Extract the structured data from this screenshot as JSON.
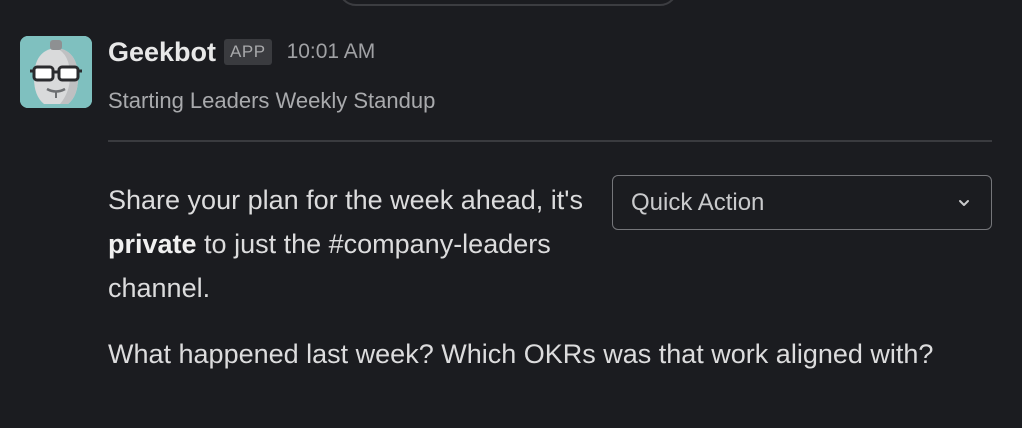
{
  "message": {
    "sender": "Geekbot",
    "badge": "APP",
    "time": "10:01 AM",
    "subtitle": "Starting Leaders Weekly Standup",
    "avatar_icon": "robot-avatar-icon"
  },
  "prompt": {
    "prefix": "Share your plan for the week ahead, it's ",
    "emphasis": "private",
    "suffix": " to just the #company-leaders channel."
  },
  "quick_action": {
    "label": "Quick Action",
    "icon": "chevron-down-icon"
  },
  "question": "What happened last week? Which OKRs was that work aligned with?",
  "colors": {
    "background": "#1b1c20",
    "avatar_bg": "#7fc0bf",
    "divider": "#3a3b3f"
  }
}
